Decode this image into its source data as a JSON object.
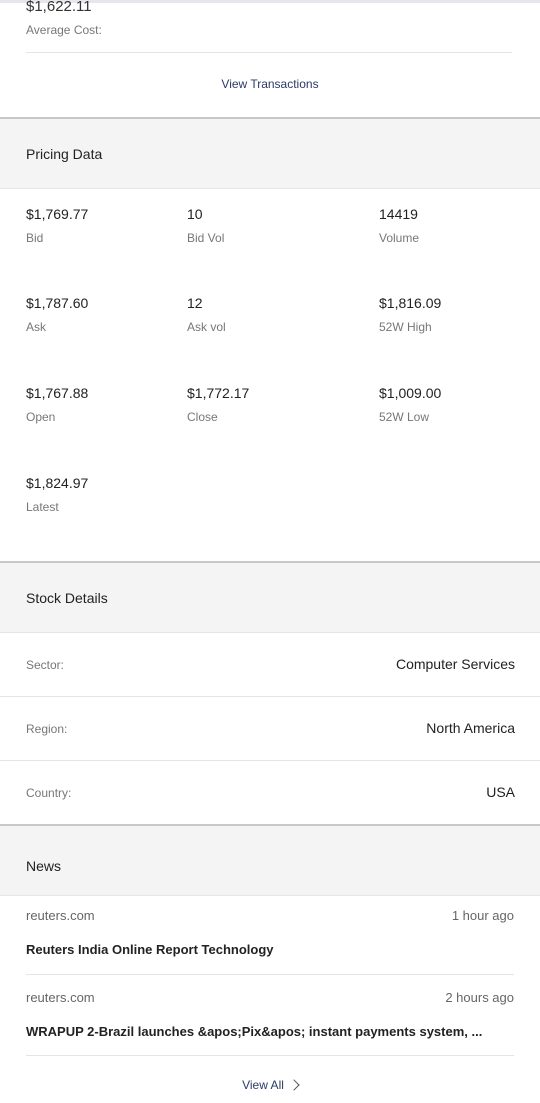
{
  "position": {
    "average_cost_value": "$1,622.11",
    "average_cost_label": "Average Cost:",
    "view_transactions_label": "View Transactions"
  },
  "pricing": {
    "title": "Pricing Data",
    "bid": {
      "value": "$1,769.77",
      "label": "Bid"
    },
    "bid_vol": {
      "value": "10",
      "label": "Bid Vol"
    },
    "volume": {
      "value": "14419",
      "label": "Volume"
    },
    "ask": {
      "value": "$1,787.60",
      "label": "Ask"
    },
    "ask_vol": {
      "value": "12",
      "label": "Ask vol"
    },
    "high_52w": {
      "value": "$1,816.09",
      "label": "52W High"
    },
    "open": {
      "value": "$1,767.88",
      "label": "Open"
    },
    "close": {
      "value": "$1,772.17",
      "label": "Close"
    },
    "low_52w": {
      "value": "$1,009.00",
      "label": "52W Low"
    },
    "latest": {
      "value": "$1,824.97",
      "label": "Latest"
    }
  },
  "stock_details": {
    "title": "Stock Details",
    "sector": {
      "label": "Sector:",
      "value": "Computer Services"
    },
    "region": {
      "label": "Region:",
      "value": "North America"
    },
    "country": {
      "label": "Country:",
      "value": "USA"
    }
  },
  "news": {
    "title": "News",
    "items": [
      {
        "source": "reuters.com",
        "time": "1 hour ago",
        "headline": "Reuters India Online Report Technology"
      },
      {
        "source": "reuters.com",
        "time": "2 hours ago",
        "headline": "WRAPUP 2-Brazil launches &apos;Pix&apos; instant payments system, ..."
      }
    ],
    "view_all_label": "View All"
  },
  "colors": {
    "link": "#2b3a67",
    "section_bg": "#f4f4f4",
    "label_gray": "#777777"
  }
}
